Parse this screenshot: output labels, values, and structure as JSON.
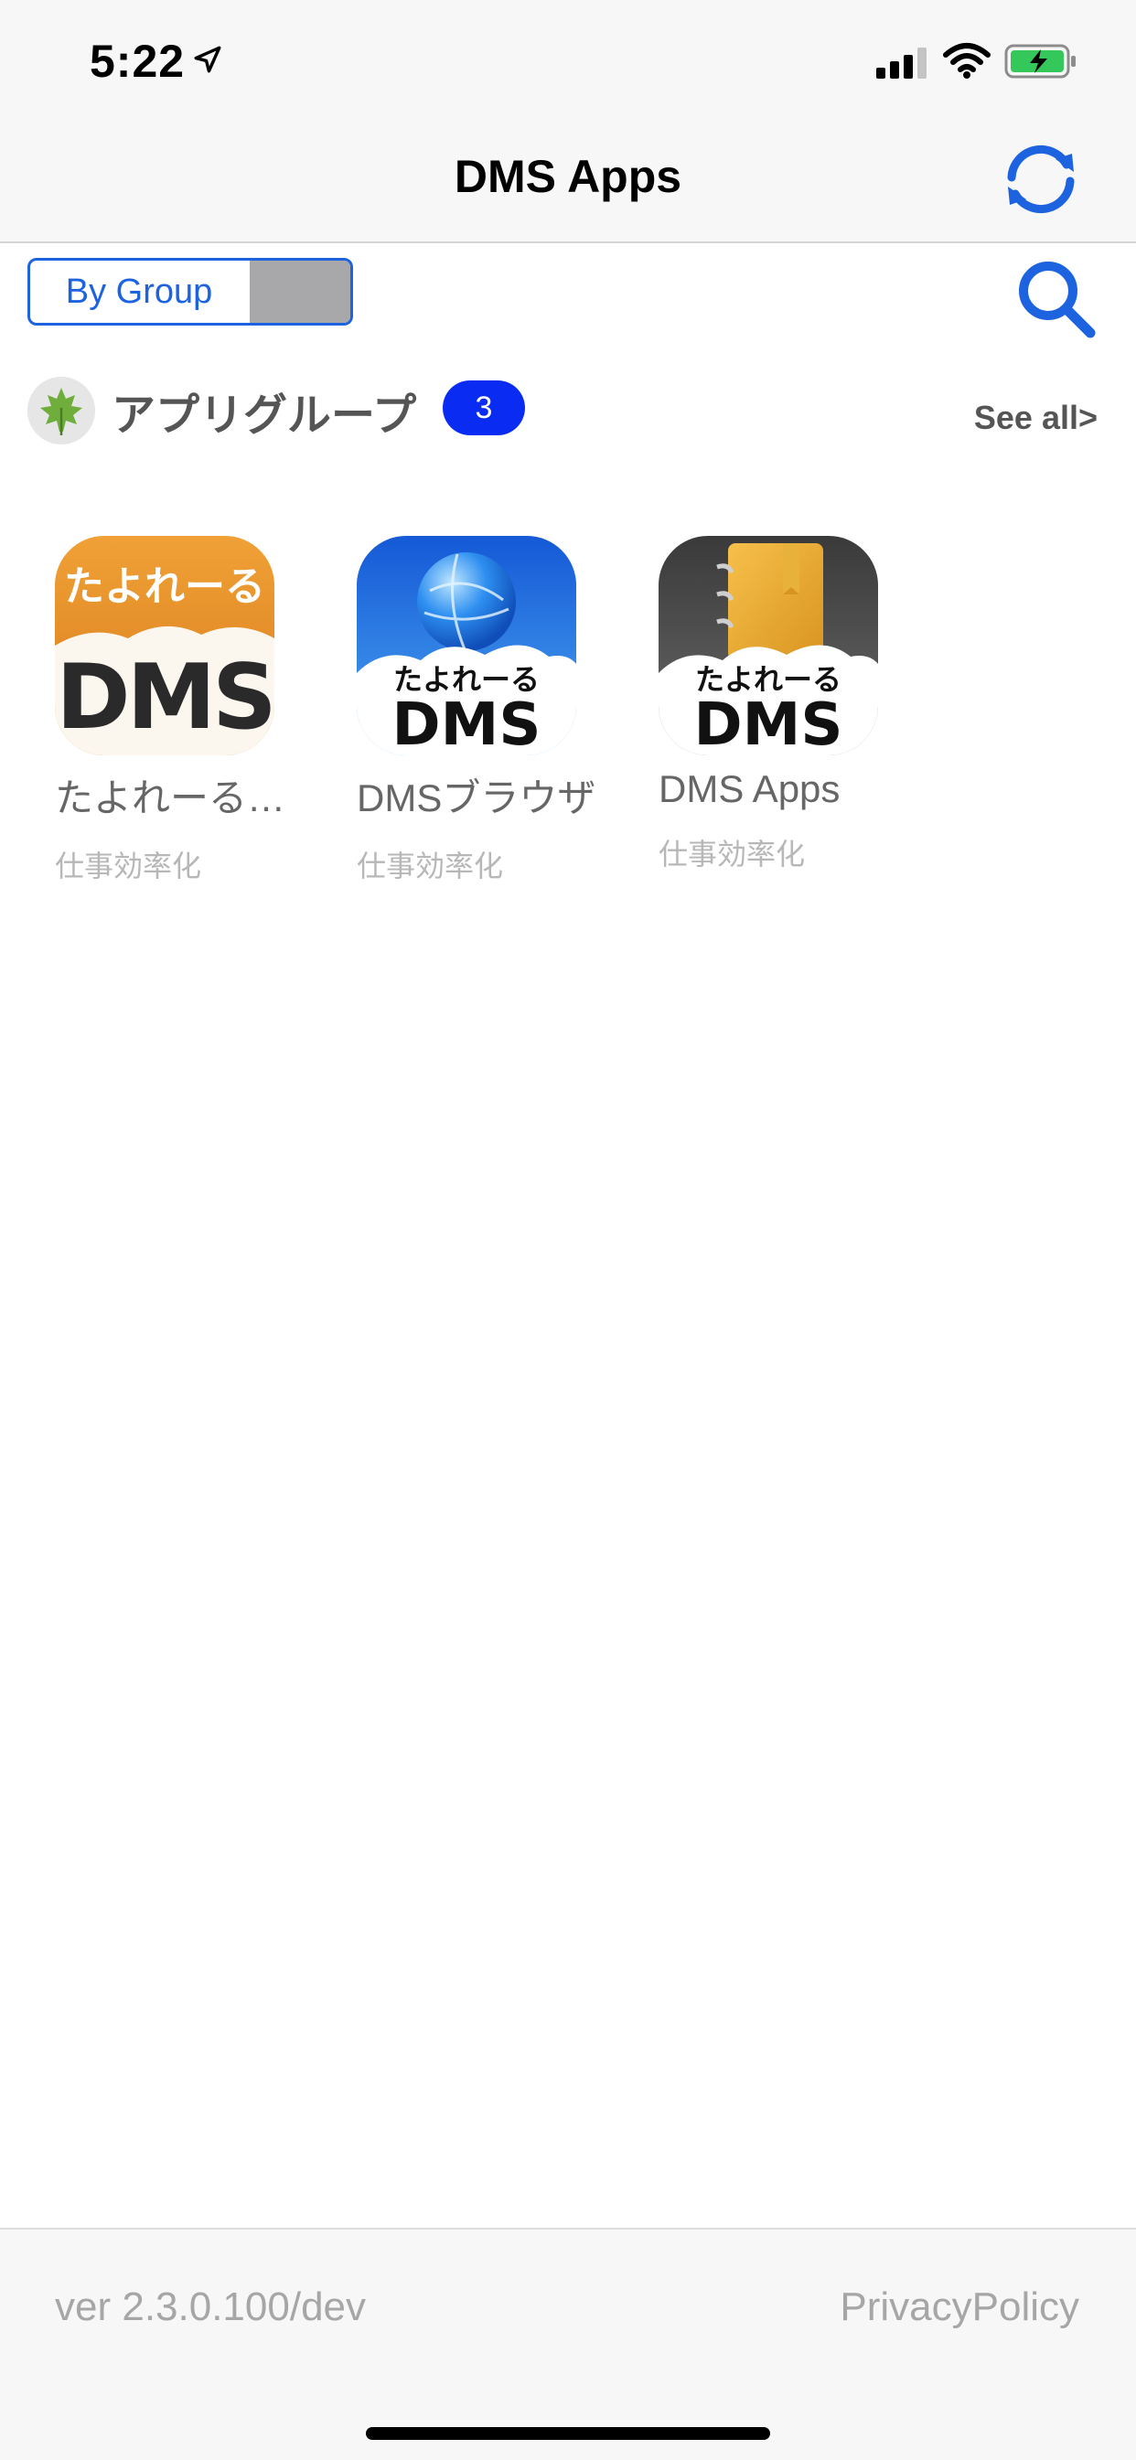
{
  "status_bar": {
    "time": "5:22"
  },
  "nav": {
    "title": "DMS Apps"
  },
  "filter": {
    "segment_label": "By Group"
  },
  "group": {
    "title": "アプリグループ",
    "count": "3",
    "see_all": "See all>"
  },
  "apps": [
    {
      "name": "たよれーる…",
      "category": "仕事効率化",
      "icon": "tayoreru-dms-orange-icon",
      "icon_top_text": "たよれーる",
      "icon_main_text": "DMS",
      "color": "#e8902a"
    },
    {
      "name": "DMSブラウザ",
      "category": "仕事効率化",
      "icon": "dms-browser-globe-icon",
      "icon_top_text": "たよれーる",
      "icon_main_text": "DMS",
      "color": "#1a6fe0"
    },
    {
      "name": "DMS Apps",
      "category": "仕事効率化",
      "icon": "dms-apps-notebook-icon",
      "icon_top_text": "たよれーる",
      "icon_main_text": "DMS",
      "color": "#4a4a4a"
    }
  ],
  "footer": {
    "version": "ver 2.3.0.100/dev",
    "privacy": "PrivacyPolicy"
  },
  "colors": {
    "accent": "#1d63e0",
    "badge": "#0a2cf2"
  }
}
